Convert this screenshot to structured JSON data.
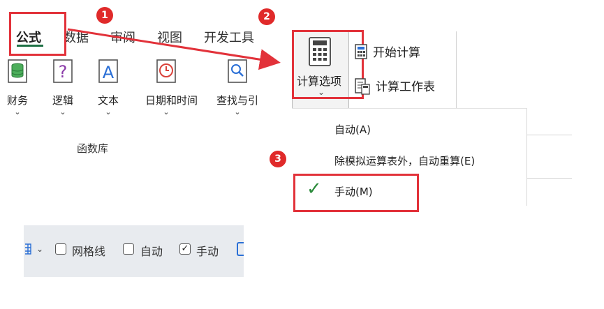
{
  "ribbon_tabs": [
    "公式",
    "数据",
    "审阅",
    "视图",
    "开发工具"
  ],
  "ribbon_buttons": [
    {
      "label": "财务",
      "icon": "database-icon"
    },
    {
      "label": "逻辑",
      "icon": "question-icon"
    },
    {
      "label": "文本",
      "icon": "text-a-icon"
    },
    {
      "label": "日期和时间",
      "icon": "clock-icon"
    },
    {
      "label": "查找与引",
      "icon": "magnifier-icon"
    }
  ],
  "group_label": "函数库",
  "calc": {
    "options_label": "计算选项",
    "start_label": "开始计算",
    "sheet_label": "计算工作表"
  },
  "menu": {
    "auto": "自动(A)",
    "auto_except": "除模拟运算表外，自动重算(E)",
    "manual": "手动(M)"
  },
  "badges": [
    "1",
    "2",
    "3"
  ],
  "status_bar": {
    "gridlines": "网格线",
    "auto": "自动",
    "manual": "手动",
    "manual_checked": "✓"
  },
  "colors": {
    "accent_red": "#e2323a",
    "badge_red": "#e02a2a",
    "check_green": "#2a8a3a",
    "tab_underline": "#1e7145"
  }
}
